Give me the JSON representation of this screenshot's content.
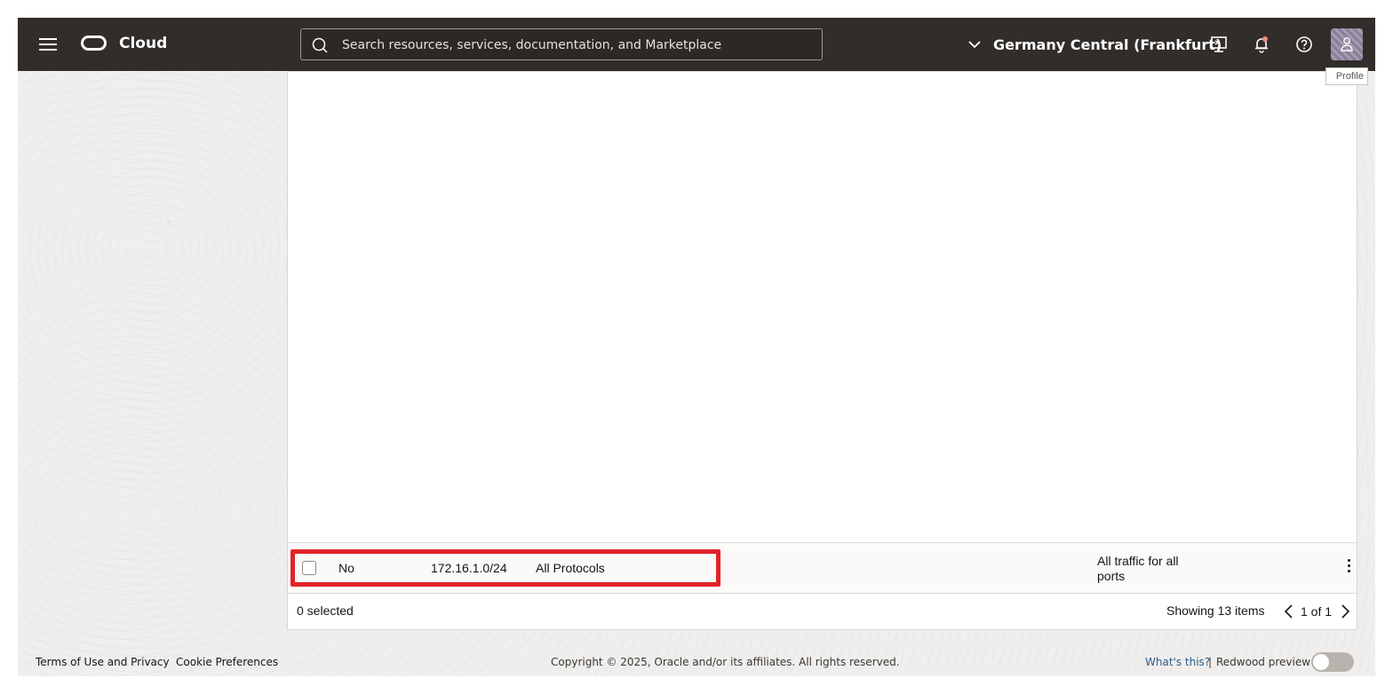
{
  "header": {
    "brand": "Cloud",
    "search_placeholder": "Search resources, services, documentation, and Marketplace",
    "region": "Germany Central (Frankfurt)",
    "tooltip": "Profile"
  },
  "table": {
    "row": {
      "stateless": "No",
      "source": "172.16.1.0/24",
      "protocol": "All Protocols",
      "description_line1": "All traffic for all",
      "description_line2": "ports"
    },
    "selected_text": "0 selected",
    "showing_text": "Showing 13 items",
    "page_text": "1 of 1"
  },
  "footer": {
    "terms": "Terms of Use and Privacy",
    "cookies": "Cookie Preferences",
    "copyright": "Copyright © 2025, Oracle and/or its affiliates. All rights reserved.",
    "whats_this": "What's this?",
    "separator": "|",
    "redwood": "Redwood preview"
  },
  "colors": {
    "topbar": "#312d2a",
    "highlight": "#e32227",
    "link": "#2c5a8a"
  },
  "icons": [
    "hamburger-icon",
    "oracle-logo-icon",
    "search-icon",
    "chevron-down-icon",
    "cloud-shell-icon",
    "notification-bell-icon",
    "help-icon",
    "profile-icon",
    "kebab-menu-icon",
    "chevron-left-icon",
    "chevron-right-icon"
  ]
}
